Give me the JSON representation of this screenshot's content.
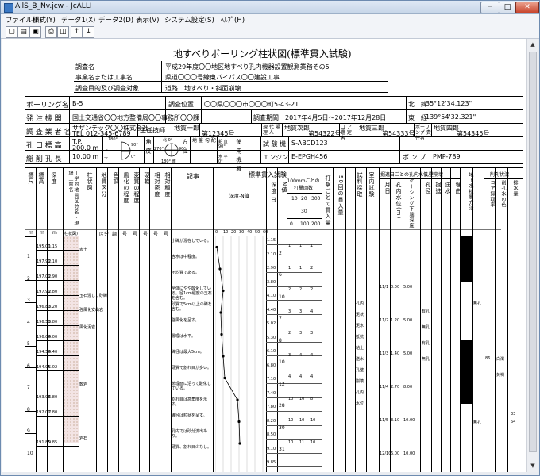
{
  "window": {
    "title": "AllS_B_Nv.jcw - JcALLI",
    "minimize": "─",
    "maximize": "□",
    "close": "✕"
  },
  "menu": [
    "ファイル(F)",
    "様式(Y)",
    "データ1(X)",
    "データ2(D)",
    "表示(V)",
    "システム設定(S)",
    "ﾍﾙﾌﾟ(H)"
  ],
  "toolbar": [
    "new-icon",
    "open-icon",
    "save-icon",
    "print-icon",
    "print-preview-icon",
    "up-arrow-icon",
    "down-arrow-icon"
  ],
  "doc": {
    "title": "地すべりボーリング柱状図(標準貫入試験)",
    "rows": [
      {
        "label": "調査名",
        "value": "平成29年度〇〇地区地すべり孔内機器設置観測業務その5"
      },
      {
        "label": "事業名または工事名",
        "value": "県道〇〇〇号線東バイパス〇〇建設工事"
      },
      {
        "label": "調査目的及び調査対象",
        "value": "道路　地すべり・斜面崩壊"
      }
    ],
    "boring_name_label": "ボーリング名",
    "boring_name": "B-5",
    "location_label": "調査位置",
    "location": "〇〇県〇〇〇市〇〇〇町5-43-21",
    "lat_label": "北　緯",
    "lat": "35°12'34.123\"",
    "issuer_label": "発 注 機 関",
    "issuer": "国土交通省〇〇地方整備局〇〇事務所〇〇課",
    "period_label": "調査期間",
    "period": "2017年4月5日〜2017年12月28日",
    "lon_label": "東　経",
    "lon": "139°54'32.321\"",
    "company_label": "調 査 業 者 名",
    "company": "サザンテック〇〇株式会社",
    "company_tel": "TEL 012-345-6789",
    "chief_label": "主任技師",
    "chief": "地質一郎",
    "chief_no": "第12345号",
    "site_label": "現 代 場 理 人",
    "site": "地質次郎",
    "site_no": "第54322号",
    "core_label": "コ ア 鑑 定 者",
    "core": "地質三郎",
    "core_no": "第54333号",
    "boring_chief_label": "ボーリング 責任者",
    "boring_chief": "地質四郎",
    "boring_chief_no": "第54345号",
    "elev_label": "孔 口 標 高",
    "elev": "T.P. 200.0 m",
    "angle_label": "角 度",
    "angle_top": "180°",
    "angle_up": "上",
    "angle_down": "下",
    "angle_r": "90°",
    "angle_zero": "0°",
    "dir_label": "方 位",
    "dir_n": "北 0°",
    "dir_w": "270°",
    "dir_e": "90°",
    "dir_s": "180° 南",
    "ground_label": "地 盤 勾 配",
    "ground_v": "鉛 直 90°",
    "ground_h": "水 平 0°",
    "machine_label": "使 用 機 種",
    "tester_label": "試 験 機",
    "tester": "S-ABCD123",
    "drill_label": "総 削 孔 長",
    "drill": "10.00 m",
    "engine_label": "エンジン",
    "engine": "E-EPGH456",
    "pump_label": "ポ ン プ",
    "pump": "PMP-789"
  },
  "log": {
    "columns": [
      "標尺",
      "標高",
      "深度",
      "層厚",
      "柱状図",
      "土質区分",
      "色調",
      "相対密度",
      "相対稠度",
      "記事"
    ],
    "col_texts": {
      "scale": "標尺",
      "elev": "標高",
      "depth": "深度",
      "thick": "工学的地質区分名・現場土質名",
      "columnar": "柱状図",
      "soil": "地質区分",
      "color": "色調",
      "weathering": "風化の程度",
      "degree": "変質の程度",
      "hardness": "硬軟",
      "rqd": "相対密度",
      "rcs": "相対稠度",
      "note": "記事"
    },
    "units": [
      "m",
      "m",
      "m",
      "(柱状図)",
      "区分",
      "調",
      "号",
      "号",
      "号",
      "号",
      "号"
    ],
    "spt_head": "標準貫入試験",
    "spt_sub": [
      "深度 m",
      "N値",
      "100mmごとの打撃回数",
      "打撃ごとの貫入量",
      "50回の貫入量"
    ],
    "spt_cols": [
      "0",
      "100",
      "200",
      "300"
    ],
    "spt_intervals": [
      "10",
      "20",
      "30"
    ],
    "graph_label": "深度-N値",
    "graph_ticks": [
      "0",
      "10",
      "20",
      "30",
      "40",
      "50",
      "60"
    ],
    "sample_head": "試料採取",
    "sample_cols": [
      "深度",
      "試料番号",
      "採取方法"
    ],
    "test_head": "室内試験",
    "mud_head": "掘進日ごとの孔内水位",
    "mud_cols": [
      "月日",
      "孔内水位(m)",
      "ケーシング下端深度"
    ],
    "well_head": "孔壁崩壊",
    "well_cols": [
      "孔径",
      "掘進",
      "送水",
      "理由"
    ],
    "obs_head": "地下水検層方法",
    "ground_head": "削孔状況",
    "ground_cols": [
      "コア採取率",
      "削孔水の色",
      "排水量"
    ],
    "depths": [
      {
        "scale": "1",
        "elev": "195.00",
        "depth": "1.15"
      },
      {
        "scale": "",
        "elev": "197.90",
        "depth": "2.10"
      },
      {
        "scale": "",
        "elev": "197.00",
        "depth": "2.90"
      },
      {
        "scale": "2",
        "elev": "197.90",
        "depth": "2.80"
      },
      {
        "scale": "3",
        "elev": "196.80",
        "depth": "3.20"
      },
      {
        "scale": "4",
        "elev": "196.50",
        "depth": "3.80"
      },
      {
        "scale": "",
        "elev": "196.00",
        "depth": "4.00"
      },
      {
        "scale": "5",
        "elev": "194.50",
        "depth": "4.40"
      },
      {
        "scale": "",
        "elev": "194.95",
        "depth": "5.02"
      },
      {
        "scale": "6",
        "elev": "",
        "depth": ""
      },
      {
        "scale": "7",
        "elev": "193.90",
        "depth": "6.80"
      },
      {
        "scale": "8",
        "elev": "192.00",
        "depth": "7.80"
      },
      {
        "scale": "9",
        "elev": "",
        "depth": ""
      },
      {
        "scale": "10",
        "elev": "191.85",
        "depth": "9.85"
      },
      {
        "scale": "11",
        "elev": "",
        "depth": ""
      }
    ],
    "soil_labels": [
      "表土",
      "玉石混じり砂礫",
      "強風化安山岩",
      "風化泥岩",
      "軟岩",
      "岩石"
    ],
    "notes": [
      "小礫が混在している。",
      "含水は中程度。",
      "不均質である。",
      "全体にやや酸化している。径1cm程度の玉石を含む。",
      "砂質で5cm以上の礫を含む。",
      "強風化を呈す。",
      "層理は水平。",
      "礫径は最大5cm。",
      "硬質で割れ目が多い。",
      "節理面に沿って酸化している。",
      "割れ目は高角度を示す。",
      "礫径は粒状を呈す。",
      "孔内では砂分流出あり。",
      "硬質、割れ目少なし。"
    ],
    "n_curve": [
      {
        "d": 1,
        "n": 2
      },
      {
        "d": 2,
        "n": 6
      },
      {
        "d": 3,
        "n": 10
      },
      {
        "d": 4,
        "n": 7
      },
      {
        "d": 5,
        "n": 8
      },
      {
        "d": 6,
        "n": 10
      },
      {
        "d": 7,
        "n": 12
      },
      {
        "d": 8,
        "n": 28
      },
      {
        "d": 9,
        "n": 30
      },
      {
        "d": 10,
        "n": 31
      }
    ],
    "depth_numbers": [
      "1.15",
      "2.10",
      "2.90",
      "3.80",
      "4.10",
      "4.40",
      "5.02",
      "5.30",
      "6.10",
      "6.80",
      "7.10",
      "7.40",
      "7.80",
      "8.20",
      "8.50",
      "9.10",
      "9.85"
    ],
    "blows": [
      [
        "1",
        "1",
        "1"
      ],
      [
        "1",
        "1",
        "2"
      ],
      [
        "2",
        "2",
        "2"
      ],
      [
        "3",
        "3",
        "4"
      ],
      [
        "2",
        "3",
        "3"
      ],
      [
        "3",
        "4",
        "4"
      ],
      [
        "4",
        "4",
        "4"
      ],
      [
        "10",
        "10",
        "8"
      ],
      [
        "10",
        "10",
        "10"
      ],
      [
        "10",
        "11",
        "10"
      ]
    ],
    "mud_rows": [
      {
        "date": "11/1",
        "level": "0.00",
        "casing": "5.00"
      },
      {
        "date": "11/2",
        "level": "1.20",
        "casing": "5.00"
      },
      {
        "date": "11/3",
        "level": "1.40",
        "casing": "5.00"
      },
      {
        "date": "11/4",
        "level": "2.70",
        "casing": "8.00"
      },
      {
        "date": "11/5",
        "level": "3.10",
        "casing": "10.00"
      },
      {
        "date": "12/10",
        "level": "6.00",
        "casing": "10.00"
      }
    ],
    "mud_tags": [
      "孔内",
      "泥状",
      "泥水",
      "抵抗",
      "粘土",
      "送水",
      "孔壁",
      "崩壊",
      "孔内",
      "水位"
    ],
    "ground_vals": [
      "86",
      "白濁",
      "黄褐",
      "33",
      "64"
    ],
    "obs_tags": [
      "有孔",
      "無孔",
      "有孔",
      "無孔"
    ],
    "obs_marks": [
      "無孔",
      "無孔"
    ]
  }
}
